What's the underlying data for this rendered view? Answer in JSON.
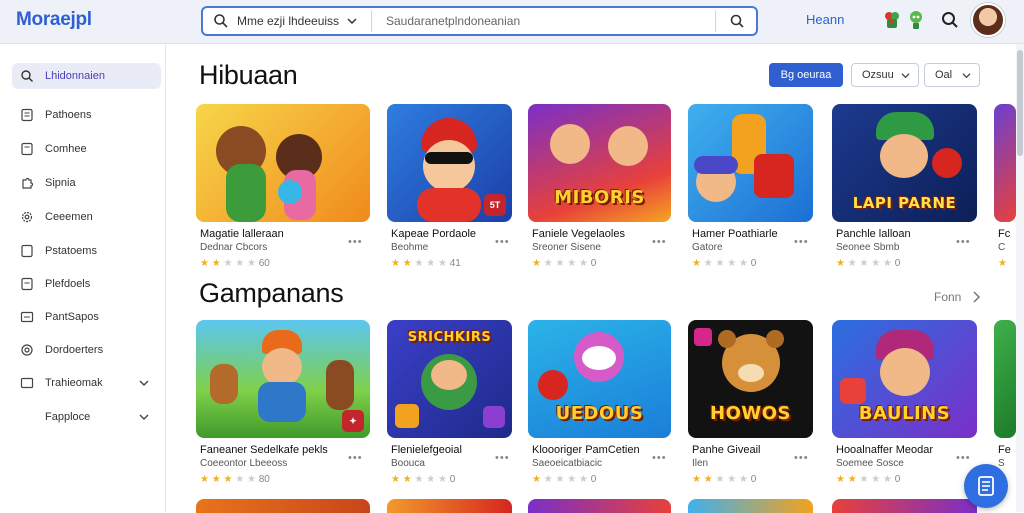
{
  "app": {
    "logo": "Moraejpl"
  },
  "search": {
    "scope": "Mme ezji lhdeeuiss",
    "placeholder": "Saudaranetplndoneanian"
  },
  "header": {
    "user_link": "Heann",
    "icons": [
      "gift-icon",
      "robot-icon",
      "search-icon"
    ]
  },
  "sidebar": {
    "items": [
      {
        "label": "Lhidonnaien",
        "icon": "search-icon",
        "active": true
      },
      {
        "label": "Pathoens",
        "icon": "document-icon"
      },
      {
        "label": "Comhee",
        "icon": "document-icon"
      },
      {
        "label": "Sipnia",
        "icon": "puzzle-icon"
      },
      {
        "label": "Ceeemen",
        "icon": "gear-icon"
      },
      {
        "label": "Pstatoems",
        "icon": "document-icon"
      },
      {
        "label": "Plefdoels",
        "icon": "document-icon"
      },
      {
        "label": "PantSapos",
        "icon": "list-icon"
      },
      {
        "label": "Dordoerters",
        "icon": "shield-icon"
      },
      {
        "label": "Trahieomak",
        "icon": "list-icon",
        "expandable": true
      },
      {
        "label": "Fapploce",
        "icon": "",
        "expandable": true
      }
    ]
  },
  "sections": [
    {
      "title": "Hibuaan",
      "buttons": {
        "primary": "Bg oeuraa",
        "select1": "Ozsuu",
        "select2": "Oal"
      },
      "cards": [
        {
          "title": "Magatie lalleraan",
          "sub": "Dednar Cbcors",
          "stars": 2,
          "count": "60"
        },
        {
          "title": "Kapeae Pordaole",
          "sub": "Beohme",
          "stars": 2,
          "count": "41"
        },
        {
          "title": "Faniele Vegelaoles",
          "sub": "Sreoner Sisene",
          "stars": 1,
          "count": "0"
        },
        {
          "title": "Hamer Poathiarle",
          "sub": "Gatore",
          "stars": 1,
          "count": "0",
          "half": true
        },
        {
          "title": "Panchle lalloan",
          "sub": "Seonee Sbmb",
          "stars": 1,
          "count": "0"
        },
        {
          "title": "Fc",
          "sub": "C",
          "stars": 1,
          "count": ""
        }
      ]
    },
    {
      "title": "Gampanans",
      "see_all": "Fonn",
      "cards": [
        {
          "title": "Faneaner Sedelkafe pekls",
          "sub": "Coeeontor Lbeeoss",
          "stars": 3,
          "count": "80"
        },
        {
          "title": "Flenielefgeoial",
          "sub": "Boouca",
          "stars": 2,
          "count": "0"
        },
        {
          "title": "Kloooriger PamCetien",
          "sub": "Saeoeicatbiacic",
          "stars": 1,
          "count": "0"
        },
        {
          "title": "Panhe Giveail",
          "sub": "Ilen",
          "stars": 2,
          "count": "0"
        },
        {
          "title": "Hooalnaffer Meodar",
          "sub": "Soemee Sosce",
          "stars": 2,
          "count": "0"
        },
        {
          "title": "Fe",
          "sub": "S",
          "stars": 1,
          "count": ""
        }
      ]
    }
  ],
  "colors": {
    "accent": "#2f5fd1",
    "star": "#f2b01e",
    "sidebar_active": "#e9ecf7"
  }
}
